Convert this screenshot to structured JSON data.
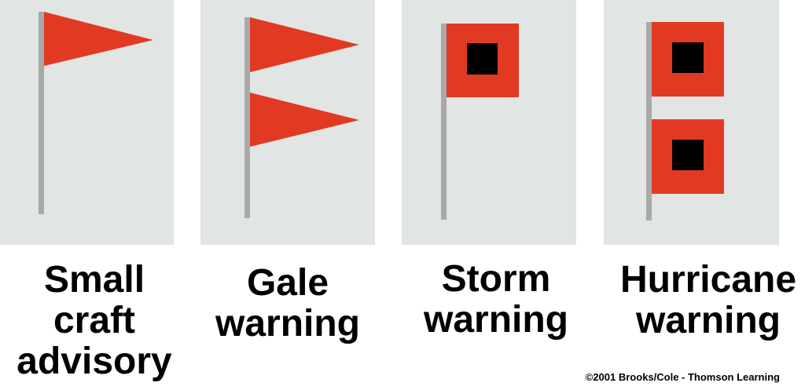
{
  "colors": {
    "panel_bg": "#e1e5e4",
    "flag_red": "#e23a22",
    "pole_gray": "#a9a9a9",
    "square_black": "#000000"
  },
  "flags": [
    {
      "name": "small-craft-advisory",
      "label_lines": [
        "Small",
        "craft",
        "advisory"
      ],
      "symbol": "one red pennant"
    },
    {
      "name": "gale-warning",
      "label_lines": [
        "Gale",
        "warning"
      ],
      "symbol": "two red pennants"
    },
    {
      "name": "storm-warning",
      "label_lines": [
        "Storm",
        "warning"
      ],
      "symbol": "one red square flag with black center"
    },
    {
      "name": "hurricane-warning",
      "label_lines": [
        "Hurricane",
        "warning"
      ],
      "symbol": "two red square flags with black centers"
    }
  ],
  "copyright": "©2001 Brooks/Cole - Thomson Learning"
}
